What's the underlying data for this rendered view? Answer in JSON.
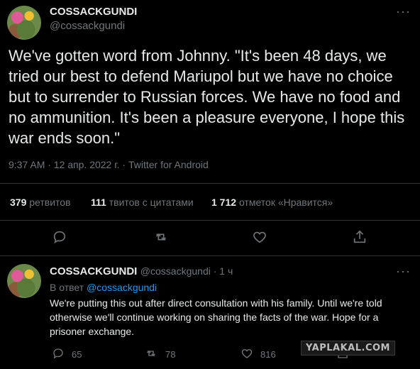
{
  "tweet": {
    "display_name": "COSSACKGUNDI",
    "handle": "@cossackgundi",
    "text": "We've gotten word from Johnny. \"It's been 48 days, we tried our best to defend Mariupol but we have no choice but to surrender to Russian forces. We have no food and no ammunition. It's been a pleasure everyone, I hope this war ends soon.\"",
    "meta": "9:37 AM · 12 апр. 2022 г. · Twitter for Android"
  },
  "stats": {
    "retweets_count": "379",
    "retweets_label": "ретвитов",
    "quotes_count": "111",
    "quotes_label": "твитов с цитатами",
    "likes_count": "1 712",
    "likes_label": "отметок «Нравится»"
  },
  "reply": {
    "display_name": "COSSACKGUNDI",
    "handle_time": "@cossackgundi · 1 ч",
    "replying_to_label": "В ответ",
    "replying_to_handle": "@cossackgundi",
    "text": "We're putting this out after direct consultation with his family. Until we're told otherwise we'll continue working on sharing the facts of the war. Hope for a prisoner exchange.",
    "reply_count": "65",
    "retweet_count": "78",
    "like_count": "816"
  },
  "watermark": "YAPLAKAL.COM",
  "icons": {
    "more": "more-icon",
    "reply": "reply-icon",
    "retweet": "retweet-icon",
    "like": "heart-icon",
    "share": "share-icon"
  }
}
